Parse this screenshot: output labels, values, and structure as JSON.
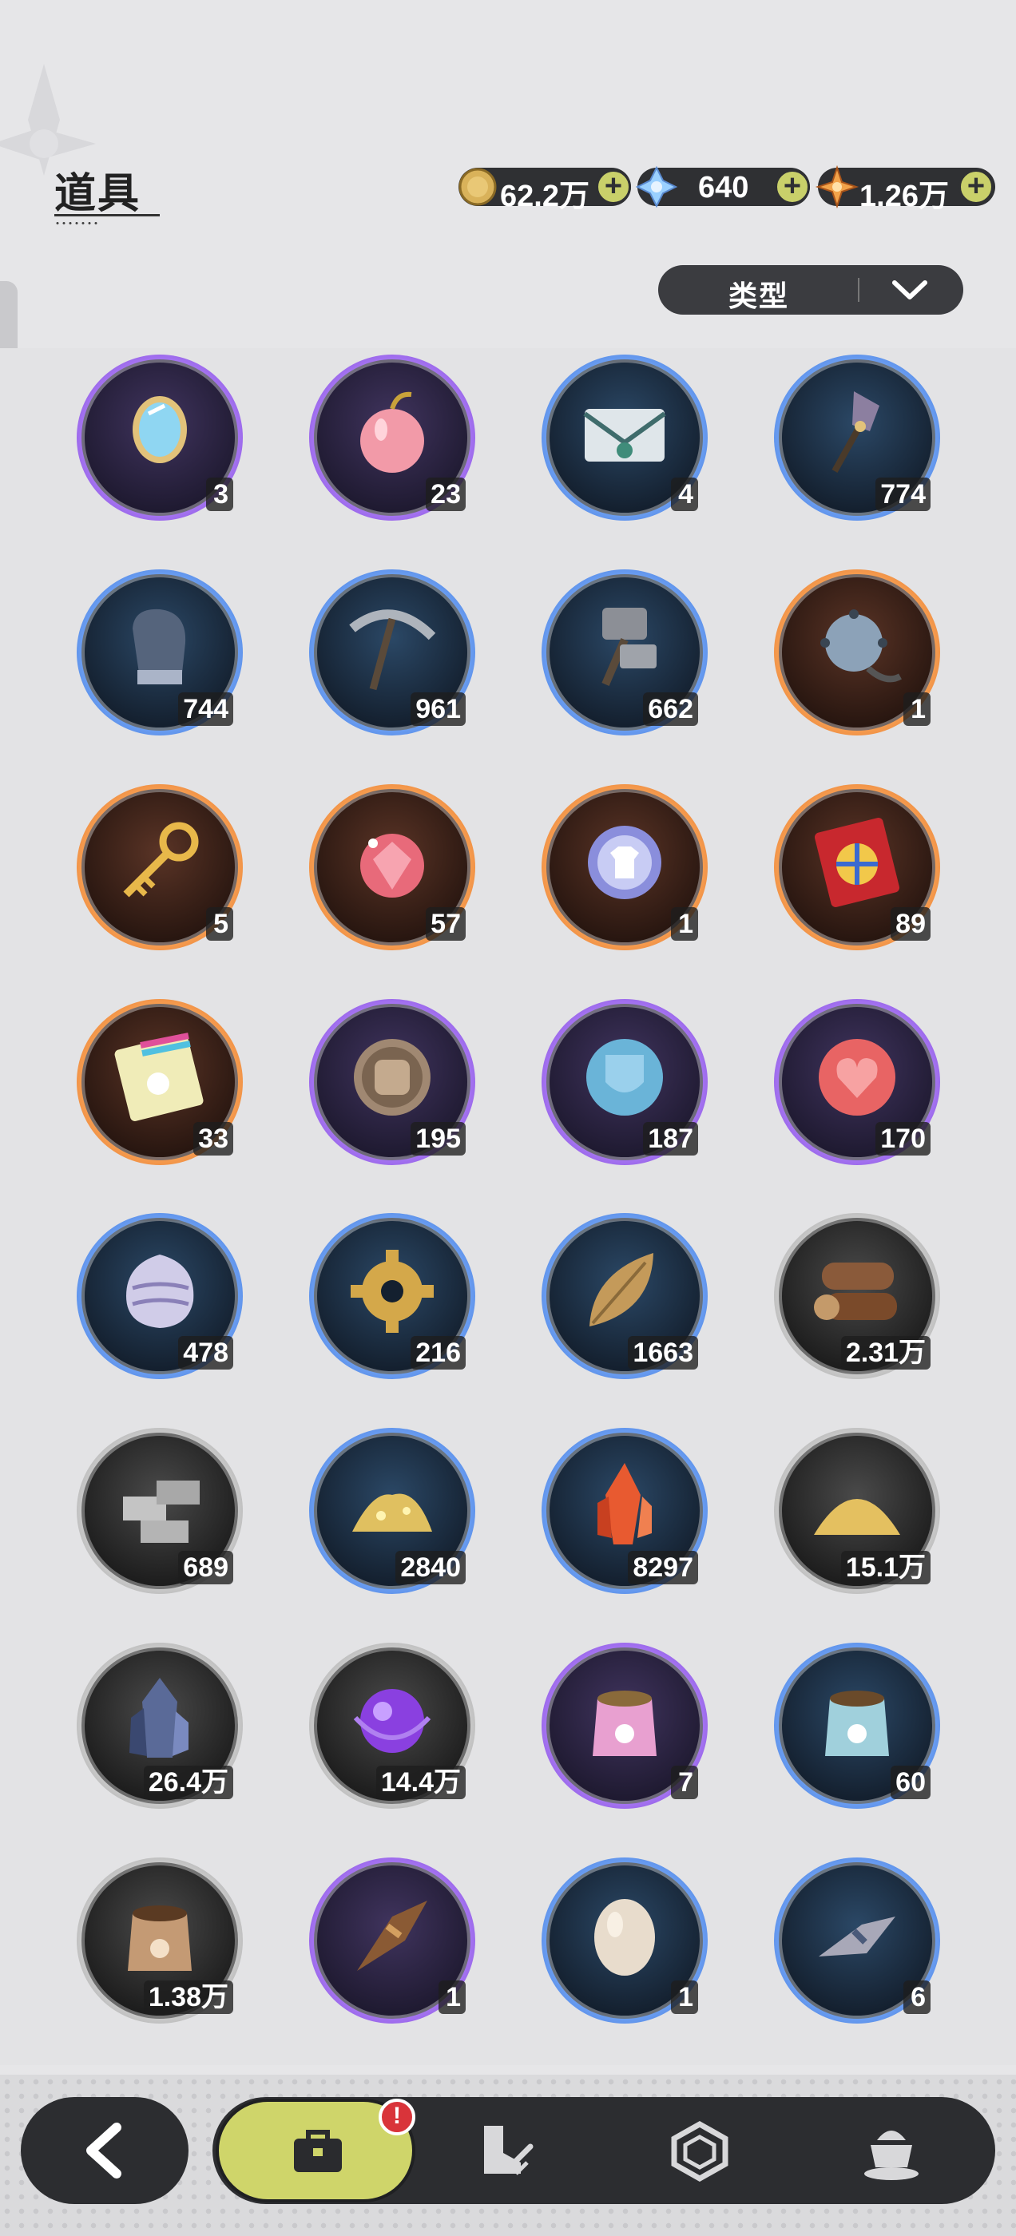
{
  "header": {
    "title": "道具"
  },
  "currencies": [
    {
      "icon": "gold-coin-icon",
      "value": "62.2万",
      "color": "#d9b25a"
    },
    {
      "icon": "crystal-gem-icon",
      "value": "640",
      "color": "#9ad0ff"
    },
    {
      "icon": "star-shard-icon",
      "value": "1.26万",
      "color": "#f2a34a"
    }
  ],
  "add_label": "+",
  "filter": {
    "label": "类型",
    "icon": "chevron-down-icon"
  },
  "items": [
    {
      "name": "mirror",
      "rarity": "purple",
      "qty": "3"
    },
    {
      "name": "apple",
      "rarity": "purple",
      "qty": "23"
    },
    {
      "name": "envelope",
      "rarity": "blue",
      "qty": "4"
    },
    {
      "name": "shovel",
      "rarity": "blue",
      "qty": "774"
    },
    {
      "name": "glove",
      "rarity": "blue",
      "qty": "744"
    },
    {
      "name": "pickaxe",
      "rarity": "blue",
      "qty": "961"
    },
    {
      "name": "hammer",
      "rarity": "blue",
      "qty": "662"
    },
    {
      "name": "spiked-ball",
      "rarity": "orange",
      "qty": "1"
    },
    {
      "name": "golden-key",
      "rarity": "orange",
      "qty": "5"
    },
    {
      "name": "crystal-apple",
      "rarity": "orange",
      "qty": "57"
    },
    {
      "name": "outfit-coin",
      "rarity": "orange",
      "qty": "1"
    },
    {
      "name": "wheel-ticket",
      "rarity": "orange",
      "qty": "89"
    },
    {
      "name": "rainbow-ticket",
      "rarity": "orange",
      "qty": "33"
    },
    {
      "name": "fist-coin",
      "rarity": "purple",
      "qty": "195"
    },
    {
      "name": "shield-coin",
      "rarity": "purple",
      "qty": "187"
    },
    {
      "name": "heart-coin",
      "rarity": "purple",
      "qty": "170"
    },
    {
      "name": "scale-egg",
      "rarity": "blue",
      "qty": "478"
    },
    {
      "name": "gear",
      "rarity": "blue",
      "qty": "216"
    },
    {
      "name": "leaf",
      "rarity": "blue",
      "qty": "1663"
    },
    {
      "name": "logs",
      "rarity": "gray",
      "qty": "2.31万"
    },
    {
      "name": "stone-bricks",
      "rarity": "gray",
      "qty": "689"
    },
    {
      "name": "gold-ore",
      "rarity": "blue",
      "qty": "2840"
    },
    {
      "name": "fire-crystal",
      "rarity": "blue",
      "qty": "8297"
    },
    {
      "name": "sand-pile",
      "rarity": "gray",
      "qty": "15.1万"
    },
    {
      "name": "dark-crystal",
      "rarity": "gray",
      "qty": "26.4万"
    },
    {
      "name": "purple-orb",
      "rarity": "gray",
      "qty": "14.4万"
    },
    {
      "name": "pink-pet-food",
      "rarity": "purple",
      "qty": "7"
    },
    {
      "name": "blue-pet-food",
      "rarity": "blue",
      "qty": "60"
    },
    {
      "name": "brown-pet-food",
      "rarity": "gray",
      "qty": "1.38万"
    },
    {
      "name": "brown-broom",
      "rarity": "purple",
      "qty": "1"
    },
    {
      "name": "egg",
      "rarity": "blue",
      "qty": "1"
    },
    {
      "name": "gray-broom",
      "rarity": "blue",
      "qty": "6"
    }
  ],
  "nav": {
    "back": "back-arrow-icon",
    "tabs": [
      "bag-icon",
      "boot-sword-icon",
      "hexagon-icon",
      "pudding-icon"
    ],
    "badge": "!"
  }
}
